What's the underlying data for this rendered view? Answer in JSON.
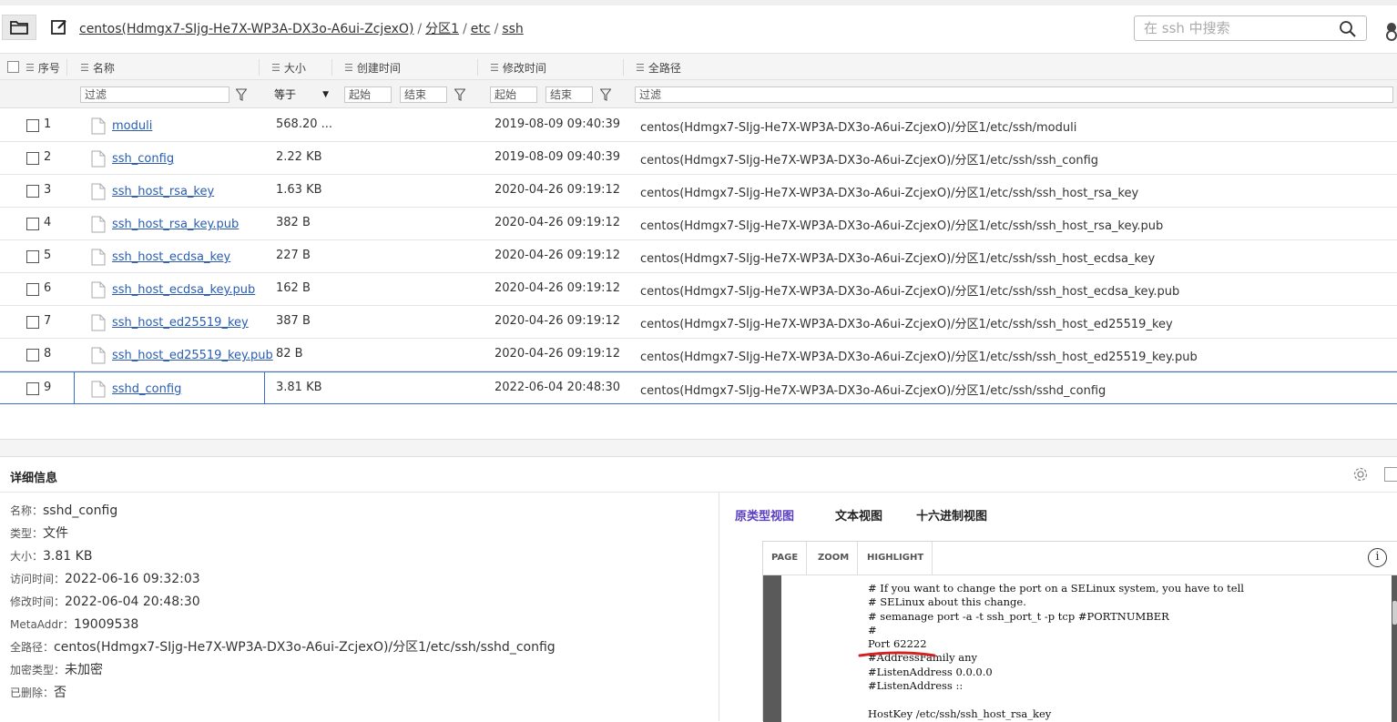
{
  "toolbar": {
    "breadcrumb": [
      "centos(Hdmgx7-SIjg-He7X-WP3A-DX3o-A6ui-ZcjexO)",
      "分区1",
      "etc",
      "ssh"
    ],
    "search_placeholder": "在 ssh 中搜索"
  },
  "table": {
    "columns": [
      "序号",
      "名称",
      "大小",
      "创建时间",
      "修改时间",
      "全路径"
    ],
    "filters": {
      "name_placeholder": "过滤",
      "size_op": "等于",
      "created_start": "起始",
      "created_end": "结束",
      "modified_start": "起始",
      "modified_end": "结束",
      "path_placeholder": "过滤"
    },
    "rows": [
      {
        "num": "1",
        "name": "moduli",
        "size": "568.20 ...",
        "mtime": "2019-08-09 09:40:39",
        "path": "centos(Hdmgx7-SIjg-He7X-WP3A-DX3o-A6ui-ZcjexO)/分区1/etc/ssh/moduli"
      },
      {
        "num": "2",
        "name": "ssh_config",
        "size": "2.22 KB",
        "mtime": "2019-08-09 09:40:39",
        "path": "centos(Hdmgx7-SIjg-He7X-WP3A-DX3o-A6ui-ZcjexO)/分区1/etc/ssh/ssh_config"
      },
      {
        "num": "3",
        "name": "ssh_host_rsa_key",
        "size": "1.63 KB",
        "mtime": "2020-04-26 09:19:12",
        "path": "centos(Hdmgx7-SIjg-He7X-WP3A-DX3o-A6ui-ZcjexO)/分区1/etc/ssh/ssh_host_rsa_key"
      },
      {
        "num": "4",
        "name": "ssh_host_rsa_key.pub",
        "size": "382 B",
        "mtime": "2020-04-26 09:19:12",
        "path": "centos(Hdmgx7-SIjg-He7X-WP3A-DX3o-A6ui-ZcjexO)/分区1/etc/ssh/ssh_host_rsa_key.pub"
      },
      {
        "num": "5",
        "name": "ssh_host_ecdsa_key",
        "size": "227 B",
        "mtime": "2020-04-26 09:19:12",
        "path": "centos(Hdmgx7-SIjg-He7X-WP3A-DX3o-A6ui-ZcjexO)/分区1/etc/ssh/ssh_host_ecdsa_key"
      },
      {
        "num": "6",
        "name": "ssh_host_ecdsa_key.pub",
        "size": "162 B",
        "mtime": "2020-04-26 09:19:12",
        "path": "centos(Hdmgx7-SIjg-He7X-WP3A-DX3o-A6ui-ZcjexO)/分区1/etc/ssh/ssh_host_ecdsa_key.pub"
      },
      {
        "num": "7",
        "name": "ssh_host_ed25519_key",
        "size": "387 B",
        "mtime": "2020-04-26 09:19:12",
        "path": "centos(Hdmgx7-SIjg-He7X-WP3A-DX3o-A6ui-ZcjexO)/分区1/etc/ssh/ssh_host_ed25519_key"
      },
      {
        "num": "8",
        "name": "ssh_host_ed25519_key.pub",
        "size": "82 B",
        "mtime": "2020-04-26 09:19:12",
        "path": "centos(Hdmgx7-SIjg-He7X-WP3A-DX3o-A6ui-ZcjexO)/分区1/etc/ssh/ssh_host_ed25519_key.pub"
      },
      {
        "num": "9",
        "name": "sshd_config",
        "size": "3.81 KB",
        "mtime": "2022-06-04 20:48:30",
        "path": "centos(Hdmgx7-SIjg-He7X-WP3A-DX3o-A6ui-ZcjexO)/分区1/etc/ssh/sshd_config",
        "selected": true
      }
    ]
  },
  "details": {
    "title": "详细信息",
    "props": [
      {
        "k": "名称：",
        "v": "sshd_config"
      },
      {
        "k": "类型：",
        "v": "文件"
      },
      {
        "k": "大小：",
        "v": "3.81 KB"
      },
      {
        "k": "访问时间：",
        "v": "2022-06-16 09:32:03"
      },
      {
        "k": "修改时间：",
        "v": "2022-06-04 20:48:30"
      },
      {
        "k": "MetaAddr：",
        "v": "19009538"
      },
      {
        "k": "全路径：",
        "v": "centos(Hdmgx7-SIjg-He7X-WP3A-DX3o-A6ui-ZcjexO)/分区1/etc/ssh/sshd_config"
      },
      {
        "k": "加密类型：",
        "v": "未加密"
      },
      {
        "k": "已删除：",
        "v": "否"
      }
    ],
    "tabs": [
      "原类型视图",
      "文本视图",
      "十六进制视图"
    ],
    "viewer_buttons": [
      "PAGE",
      "ZOOM",
      "HIGHLIGHT"
    ],
    "code_lines": [
      "# If you want to change the port on a SELinux system, you have to tell",
      "# SELinux about this change.",
      "# semanage port -a -t ssh_port_t -p tcp #PORTNUMBER",
      "#",
      "Port 62222",
      "#AddressFamily any",
      "#ListenAddress 0.0.0.0",
      "#ListenAddress ::",
      "",
      "HostKey /etc/ssh/ssh_host_rsa_key"
    ]
  },
  "colors": {
    "accent": "#5b3fc2",
    "link": "#2a5db0",
    "selection": "#3b6ec9",
    "annotation": "#d42020"
  }
}
